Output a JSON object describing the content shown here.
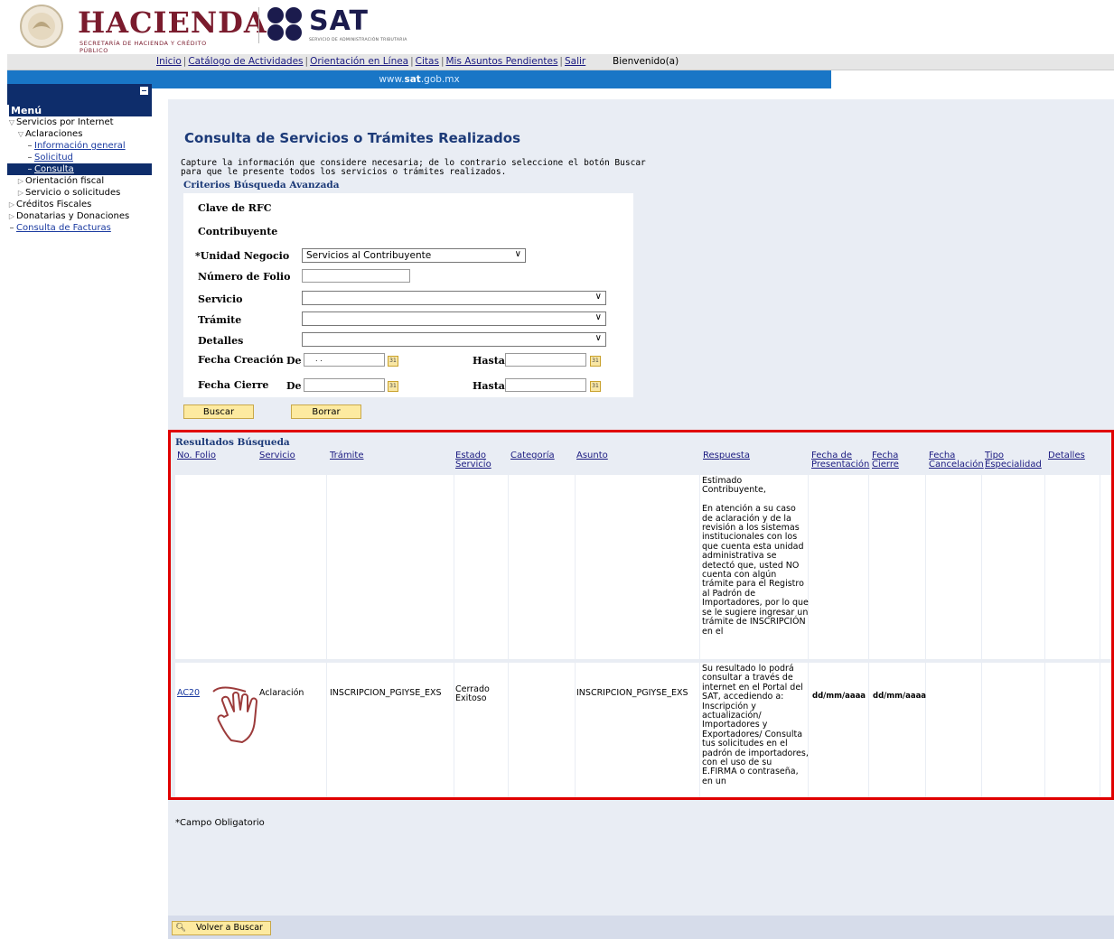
{
  "header": {
    "hacienda_word": "HACIENDA",
    "hacienda_sub": "SECRETARÍA DE HACIENDA Y CRÉDITO PÚBLICO",
    "sat_word": "SAT",
    "sat_sub": "SERVICIO DE ADMINISTRACIÓN TRIBUTARIA"
  },
  "nav": {
    "links": [
      "Inicio",
      "Catálogo de Actividades",
      "Orientación en Línea",
      "Citas",
      "Mis Asuntos Pendientes",
      "Salir"
    ],
    "welcome": "Bienvenido(a)",
    "url_prefix": "www.",
    "url_bold": "sat",
    "url_suffix": ".gob.mx"
  },
  "sidebar": {
    "title": "Menú",
    "items": [
      {
        "label": "Servicios por Internet",
        "kind": "expanded"
      },
      {
        "label": "Aclaraciones",
        "kind": "expanded"
      },
      {
        "label": "Información general",
        "kind": "link"
      },
      {
        "label": "Solicitud",
        "kind": "link"
      },
      {
        "label": "Consulta",
        "kind": "active"
      },
      {
        "label": "Orientación fiscal",
        "kind": "collapsed"
      },
      {
        "label": "Servicio o solicitudes",
        "kind": "collapsed"
      },
      {
        "label": "Créditos Fiscales",
        "kind": "collapsed"
      },
      {
        "label": "Donatarias y Donaciones",
        "kind": "collapsed"
      },
      {
        "label": "Consulta de Facturas",
        "kind": "link"
      }
    ]
  },
  "main": {
    "title": "Consulta de Servicios o Trámites Realizados",
    "instructions": "Capture la información que considere necesaria; de lo contrario seleccione el botón Buscar para que le presente todos los servicios o trámites realizados.",
    "criteria_title": "Criterios Búsqueda Avanzada"
  },
  "form": {
    "rfc_label": "Clave de RFC",
    "contribuyente_label": "Contribuyente",
    "unidad_label": "*Unidad Negocio",
    "unidad_value": "Servicios al Contribuyente",
    "folio_label": "Número de Folio",
    "servicio_label": "Servicio",
    "tramite_label": "Trámite",
    "detalles_label": "Detalles",
    "fecha_creacion_label": "Fecha Creación",
    "fecha_cierre_label": "Fecha Cierre",
    "de_label": "De",
    "hasta_label": "Hasta",
    "fecha_creacion_de": ". .",
    "buscar": "Buscar",
    "borrar": "Borrar"
  },
  "results": {
    "title": "Resultados Búsqueda",
    "columns": [
      "No. Folio",
      "Servicio",
      "Trámite",
      "Estado Servicio",
      "Categoría",
      "Asunto",
      "Respuesta",
      "Fecha de Presentación",
      "Fecha Cierre",
      "Fecha Cancelación",
      "Tipo Especialidad",
      "Detalles"
    ],
    "row1_respuesta": "Estimado Contribuyente,\n\nEn atención a su caso de aclaración y de la revisión a los sistemas institucionales con los que cuenta esta unidad administrativa se detectó que, usted NO cuenta con algún trámite para el Registro al Padrón de Importadores, por lo que se le sugiere ingresar un trámite de INSCRIPCIÓN en el",
    "row2": {
      "folio": "AC20",
      "servicio": "Aclaración",
      "tramite": "INSCRIPCION_PGIYSE_EXS",
      "estado": "Cerrado Exitoso",
      "asunto": "INSCRIPCION_PGIYSE_EXS",
      "respuesta": "Su resultado lo podrá consultar a través de internet en el Portal del SAT, accediendo a: Inscripción y actualización/ Importadores y Exportadores/ Consulta tus solicitudes en el padrón de importadores, con el uso de su E.FIRMA o contraseña, en un",
      "fecha_presentacion": "dd/mm/aaaa",
      "fecha_cierre": "dd/mm/aaaa"
    }
  },
  "footer": {
    "note": "*Campo Obligatorio",
    "back_button": "Volver a Buscar"
  },
  "colors": {
    "title_blue": "#1c3a78",
    "menu_navy": "#0e2d6b",
    "url_bar_blue": "#1976c6",
    "button_yellow": "#fdeaa0",
    "highlight_red": "#e00000",
    "hacienda_wine": "#7a1b2d"
  },
  "icons": [
    "seal-icon",
    "sat-dots-icon",
    "collapse-icon",
    "dropdown-arrow-icon",
    "calendar-icon",
    "magnifier-icon",
    "hand-pointer-icon"
  ]
}
